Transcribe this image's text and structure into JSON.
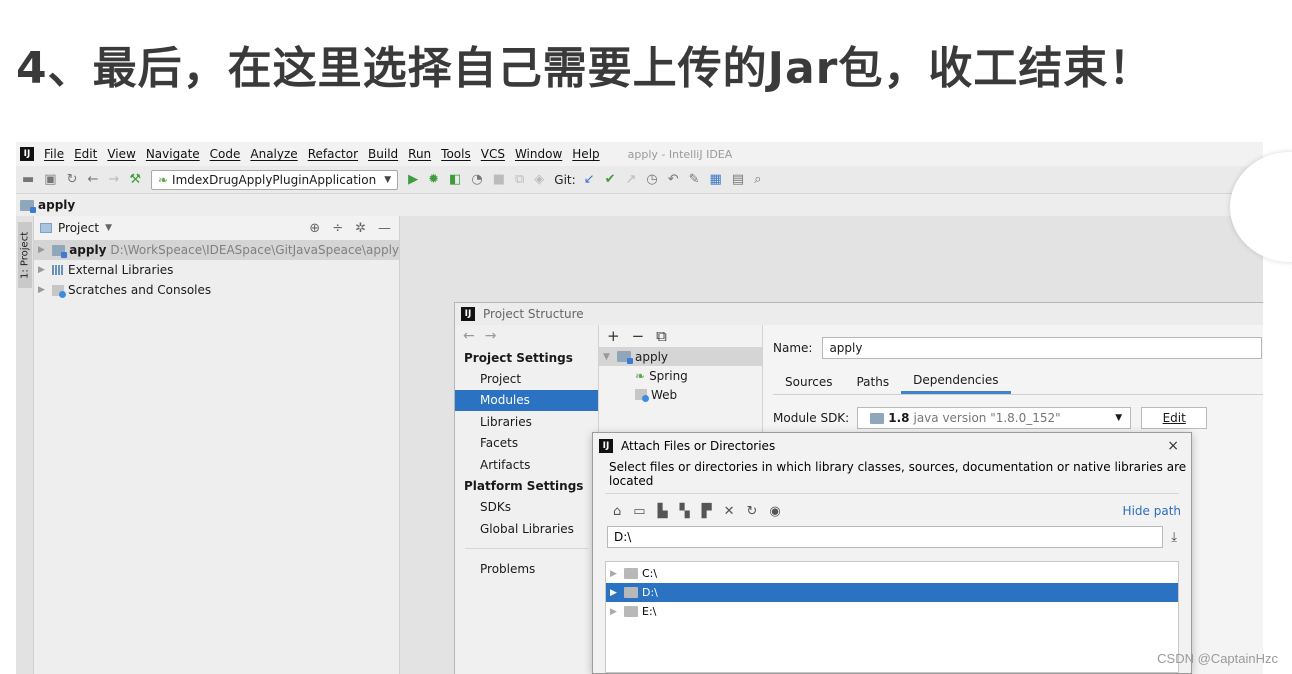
{
  "headline": "4、最后，在这里选择自己需要上传的Jar包，收工结束！",
  "menu": {
    "logo": "IJ",
    "items": [
      "File",
      "Edit",
      "View",
      "Navigate",
      "Code",
      "Analyze",
      "Refactor",
      "Build",
      "Run",
      "Tools",
      "VCS",
      "Window",
      "Help"
    ],
    "window_title": "apply - IntelliJ IDEA"
  },
  "toolbar": {
    "run_config": "ImdexDrugApplyPluginApplication",
    "git_label": "Git:"
  },
  "navbar": {
    "project": "apply"
  },
  "side_tab": "1: Project",
  "project_panel": {
    "header": "Project",
    "rows": [
      {
        "name": "apply",
        "path": "D:\\WorkSpeace\\IDEASpace\\GitJavaSpeace\\apply"
      },
      {
        "name": "External Libraries"
      },
      {
        "name": "Scratches and Consoles"
      }
    ]
  },
  "project_structure": {
    "title": "Project Structure",
    "sections": {
      "project_settings": "Project Settings",
      "project_settings_items": [
        "Project",
        "Modules",
        "Libraries",
        "Facets",
        "Artifacts"
      ],
      "platform_settings": "Platform Settings",
      "platform_settings_items": [
        "SDKs",
        "Global Libraries"
      ],
      "problems": "Problems"
    },
    "selected_item": "Modules",
    "modules": {
      "root": "apply",
      "children": [
        "Spring",
        "Web"
      ]
    },
    "name_label": "Name:",
    "name_value": "apply",
    "tabs": [
      "Sources",
      "Paths",
      "Dependencies"
    ],
    "active_tab": "Dependencies",
    "sdk_label": "Module SDK:",
    "sdk_value": "1.8",
    "sdk_version": "java version \"1.8.0_152\"",
    "edit_label": "Edit"
  },
  "attach_dialog": {
    "title": "Attach Files or Directories",
    "close": "×",
    "description": "Select files or directories in which library classes, sources, documentation or native libraries are located",
    "hide_path": "Hide path",
    "path_value": "D:\\",
    "drives": [
      "C:\\",
      "D:\\",
      "E:\\"
    ],
    "selected_drive": "D:\\"
  },
  "watermark": "CSDN @CaptainHzc"
}
